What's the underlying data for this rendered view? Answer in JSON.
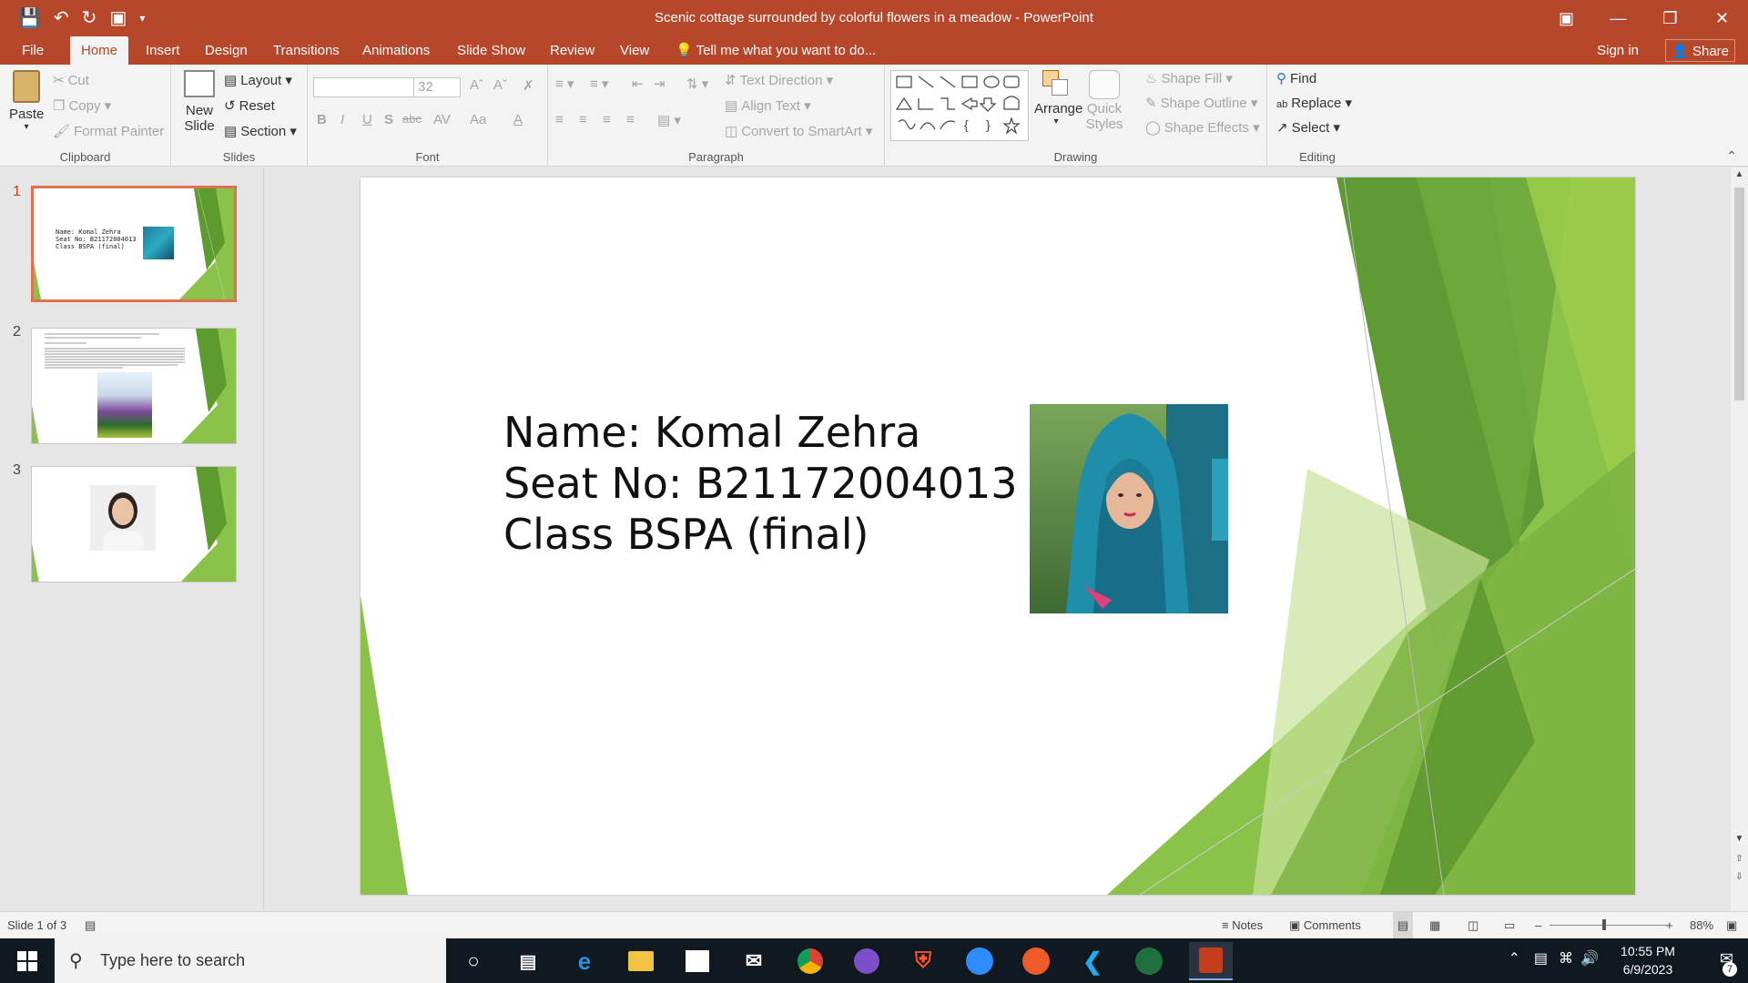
{
  "window": {
    "title": "Scenic cottage surrounded by colorful flowers in a meadow - PowerPoint",
    "sign_in": "Sign in",
    "share": "Share"
  },
  "tabs": [
    "File",
    "Home",
    "Insert",
    "Design",
    "Transitions",
    "Animations",
    "Slide Show",
    "Review",
    "View"
  ],
  "tell_me": "Tell me what you want to do...",
  "ribbon": {
    "clipboard": {
      "paste": "Paste",
      "cut": "Cut",
      "copy": "Copy",
      "format_painter": "Format Painter",
      "label": "Clipboard"
    },
    "slides": {
      "new_slide_1": "New",
      "new_slide_2": "Slide",
      "layout": "Layout",
      "reset": "Reset",
      "section": "Section",
      "label": "Slides"
    },
    "font": {
      "size": "32",
      "label": "Font",
      "bold": "B",
      "italic": "I",
      "underline": "U",
      "shadow": "S",
      "strike": "abc",
      "spacing": "AV",
      "case": "Aa",
      "color": "A"
    },
    "paragraph": {
      "text_direction": "Text Direction",
      "align_text": "Align Text",
      "smartart": "Convert to SmartArt",
      "label": "Paragraph"
    },
    "drawing": {
      "arrange": "Arrange",
      "quick_styles_1": "Quick",
      "quick_styles_2": "Styles",
      "shape_fill": "Shape Fill",
      "shape_outline": "Shape Outline",
      "shape_effects": "Shape Effects",
      "label": "Drawing"
    },
    "editing": {
      "find": "Find",
      "replace": "Replace",
      "select": "Select",
      "label": "Editing"
    }
  },
  "thumbnails": [
    {
      "num": "1",
      "lines": [
        "Name: Komal Zehra",
        "Seat No: B21172004013",
        "Class BSPA (final)"
      ]
    },
    {
      "num": "2"
    },
    {
      "num": "3"
    }
  ],
  "slide": {
    "lines": [
      "Name: Komal Zehra",
      "Seat No: B21172004013",
      "Class BSPA (final)"
    ]
  },
  "status": {
    "slide_info": "Slide 1 of 3",
    "notes": "Notes",
    "comments": "Comments",
    "zoom": "88%"
  },
  "taskbar": {
    "search_placeholder": "Type here to search",
    "time": "10:55 PM",
    "date": "6/9/2023",
    "notification_count": "7"
  },
  "colors": {
    "accent": "#b7472a",
    "green_dark": "#5a8f2a",
    "green_mid": "#7cb342",
    "green_light": "#a5d152"
  }
}
